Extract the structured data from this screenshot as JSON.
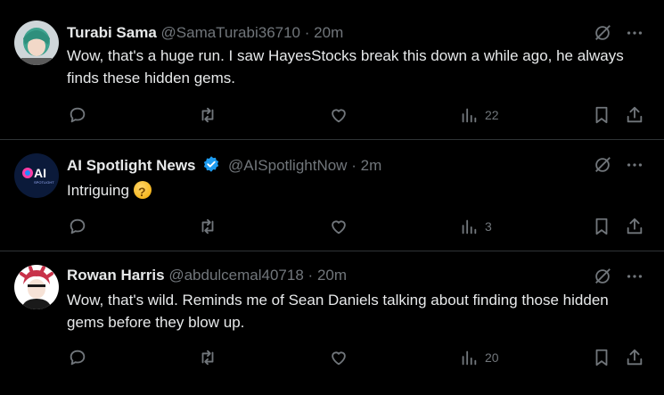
{
  "tweets": [
    {
      "name": "Turabi Sama",
      "handle": "@SamaTurabi36710",
      "separator": "·",
      "time": "20m",
      "text": "Wow, that's a huge run. I saw HayesStocks break this down a while ago, he always finds these hidden gems.",
      "views": "22",
      "verified": false
    },
    {
      "name": "AI Spotlight News",
      "handle": "@AISpotlightNow",
      "separator": "·",
      "time": "2m",
      "text": "Intriguing",
      "emoji": "thinking-face",
      "views": "3",
      "verified": true,
      "avatar_text": "AI",
      "avatar_subtext": "SPOTLIGHT"
    },
    {
      "name": "Rowan Harris",
      "handle": "@abdulcemal40718",
      "separator": "·",
      "time": "20m",
      "text": "Wow, that's wild. Reminds me of Sean Daniels talking about finding those hidden gems before they blow up.",
      "views": "20",
      "verified": false
    }
  ],
  "colors": {
    "background": "#000000",
    "text": "#e7e9ea",
    "muted": "#71767b",
    "verified": "#1d9bf0",
    "divider": "#2f3336"
  },
  "icons": [
    "reply-icon",
    "retweet-icon",
    "like-icon",
    "views-icon",
    "bookmark-icon",
    "share-icon",
    "grok-icon",
    "more-icon",
    "verified-icon"
  ]
}
